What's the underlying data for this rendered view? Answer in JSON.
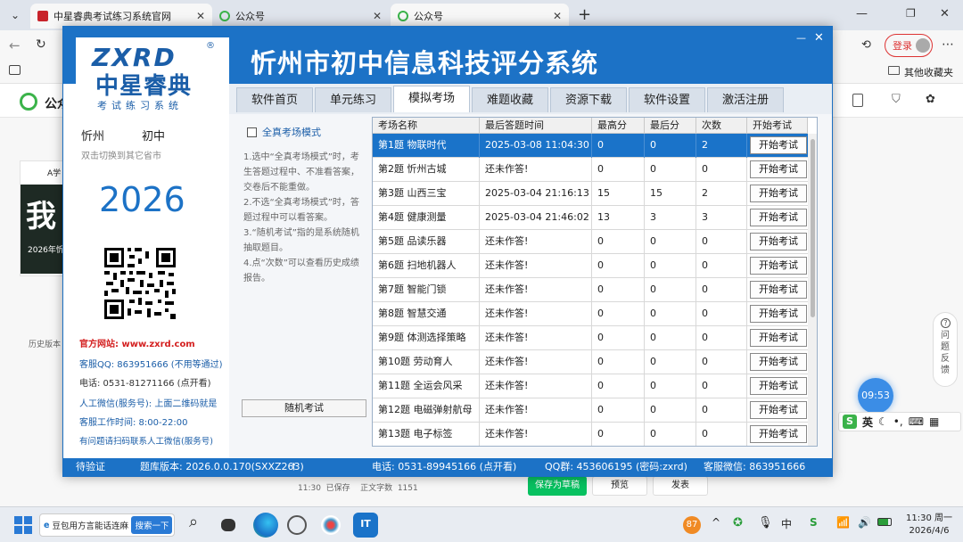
{
  "browser": {
    "tabs": [
      {
        "label": "中星睿典考试练习系统官网"
      },
      {
        "label": "公众号"
      },
      {
        "label": "公众号"
      }
    ],
    "login_label": "登录",
    "fav_other": "其他收藏夹"
  },
  "background_page": {
    "title_fragment": "公众",
    "card_label": "A学",
    "card_big": "我",
    "card_caption": "2026年忻",
    "history_label": "历史版本",
    "editor_status": "11:30  已保存    正文字数  1151",
    "save_draft": "保存为草稿",
    "preview": "预览",
    "publish": "发表",
    "feedback": "问题反馈",
    "clock_bubble": "09:53",
    "ime_lang": "英"
  },
  "app": {
    "logo_text": "ZXRD",
    "logo_cn": "中星睿典",
    "logo_sub": "考试练习系统",
    "title": "忻州市初中信息科技评分系统",
    "region": "忻州",
    "level": "初中",
    "switch_hint": "双击切换到其它省市",
    "year": "2026",
    "contact": {
      "website_label": "官方网站: www.zxrd.com",
      "qq": "客服QQ: 863951666 (不用等通过)",
      "phone": "电话: 0531-81271166 (点开看)",
      "wechat": "人工微信(服务号): 上面二维码就是",
      "hours": "客服工作时间: 8:00-22:00",
      "note": "有问题请扫码联系人工微信(服务号)"
    },
    "nav_tabs": [
      "软件首页",
      "单元练习",
      "模拟考场",
      "难题收藏",
      "资源下载",
      "软件设置",
      "激活注册"
    ],
    "active_tab": 2,
    "checkbox_label": "全真考场模式",
    "instructions": [
      "1.选中“全真考场模式”时，考生答题过程中、不准看答案，交卷后不能重做。",
      "2.不选“全真考场模式”时，答题过程中可以看答案。",
      "3.“随机考试”指的是系统随机抽取题目。",
      "4.点“次数”可以查看历史成绩报告。"
    ],
    "random_button": "随机考试",
    "table": {
      "headers": [
        "考场名称",
        "最后答题时间",
        "最高分",
        "最后分",
        "次数",
        "开始考试"
      ],
      "start_label": "开始考试",
      "rows": [
        [
          "第1题 物联时代",
          "2025-03-08 11:04:30",
          "0",
          "0",
          "2"
        ],
        [
          "第2题 忻州古城",
          "还未作答!",
          "0",
          "0",
          "0"
        ],
        [
          "第3题 山西三宝",
          "2025-03-04 21:16:13",
          "15",
          "15",
          "2"
        ],
        [
          "第4题 健康测量",
          "2025-03-04 21:46:02",
          "13",
          "3",
          "3"
        ],
        [
          "第5题 品读乐器",
          "还未作答!",
          "0",
          "0",
          "0"
        ],
        [
          "第6题 扫地机器人",
          "还未作答!",
          "0",
          "0",
          "0"
        ],
        [
          "第7题 智能门锁",
          "还未作答!",
          "0",
          "0",
          "0"
        ],
        [
          "第8题 智慧交通",
          "还未作答!",
          "0",
          "0",
          "0"
        ],
        [
          "第9题 体测选择策略",
          "还未作答!",
          "0",
          "0",
          "0"
        ],
        [
          "第10题 劳动育人",
          "还未作答!",
          "0",
          "0",
          "0"
        ],
        [
          "第11题 全运会风采",
          "还未作答!",
          "0",
          "0",
          "0"
        ],
        [
          "第12题 电磁弹射航母",
          "还未作答!",
          "0",
          "0",
          "0"
        ],
        [
          "第13题 电子标签",
          "还未作答!",
          "0",
          "0",
          "0"
        ]
      ]
    },
    "status_bar": {
      "verify": "待验证",
      "version": "题库版本: 2026.0.0.170(SXXZ263)",
      "phone": "电话: 0531-89945166 (点开看)",
      "qq_group": "QQ群: 453606195 (密码:zxrd)",
      "wechat": "客服微信: 863951666"
    }
  },
  "taskbar": {
    "search_text": "豆包用方言能话连麻",
    "search_button": "搜索一下",
    "badge": "87",
    "time": "11:30 周一",
    "date": "2026/4/6"
  },
  "colors": {
    "app_blue": "#1c72c6",
    "logo_red": "#e3262b",
    "logo_blue": "#1b5ea8",
    "link_red": "#d42020"
  }
}
